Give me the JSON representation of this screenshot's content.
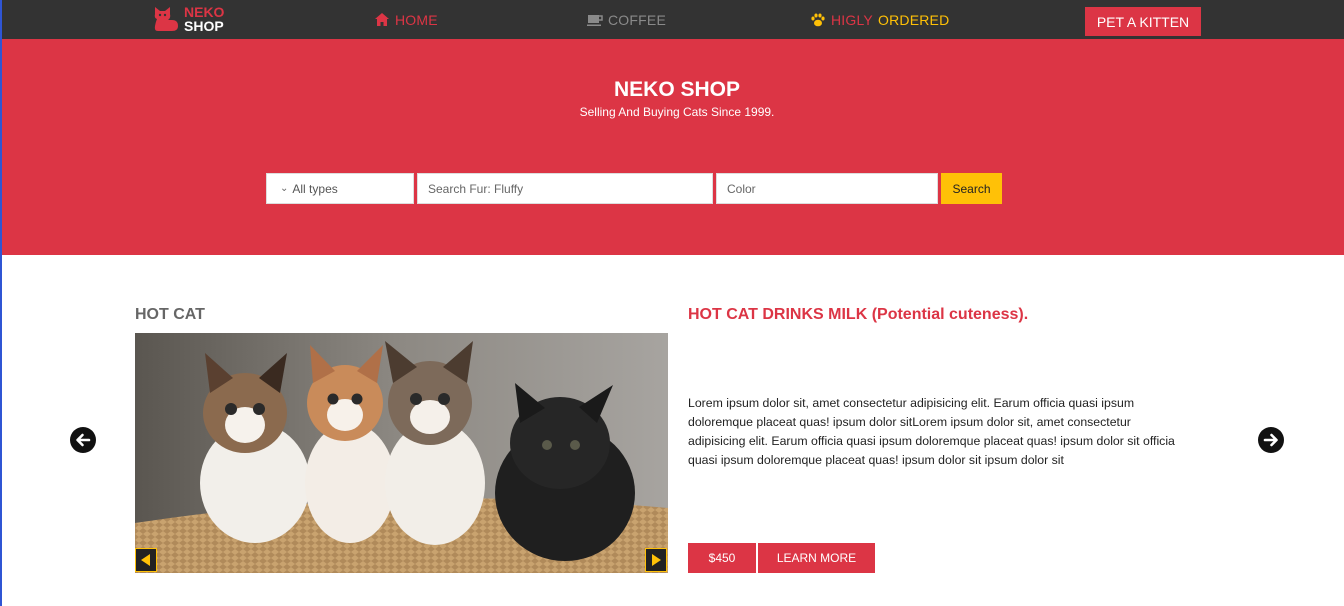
{
  "nav": {
    "brand_top": "NEKO",
    "brand_bottom": "SHOP",
    "home_label": "HOME",
    "coffee_label": "COFFEE",
    "ordered_label_1": "HIGLY",
    "ordered_label_2": "ORDERED",
    "pet_button": "PET A KITTEN",
    "icons": [
      "cat-logo-icon",
      "home-icon",
      "coffee-icon",
      "paw-icon"
    ]
  },
  "hero": {
    "title": "NEKO SHOP",
    "subtitle": "Selling And Buying Cats Since 1999."
  },
  "search": {
    "type_selected": "All types",
    "fur_placeholder": "Search Fur: Fluffy",
    "color_placeholder": "Color",
    "button_label": "Search"
  },
  "featured": {
    "section_label": "HOT CAT",
    "title": "HOT CAT DRINKS MILK (Potential cuteness).",
    "description": "Lorem ipsum dolor sit, amet consectetur adipisicing elit. Earum officia quasi ipsum doloremque placeat quas! ipsum dolor sitLorem ipsum dolor sit, amet consectetur adipisicing elit. Earum officia quasi ipsum doloremque placeat quas! ipsum dolor sit officia quasi ipsum doloremque placeat quas! ipsum dolor sit ipsum dolor sit",
    "price": "$450",
    "learn_more": "LEARN MORE"
  },
  "colors": {
    "brand_red": "#dc3545",
    "accent_yellow": "#ffc107",
    "nav_bg": "#333333"
  }
}
